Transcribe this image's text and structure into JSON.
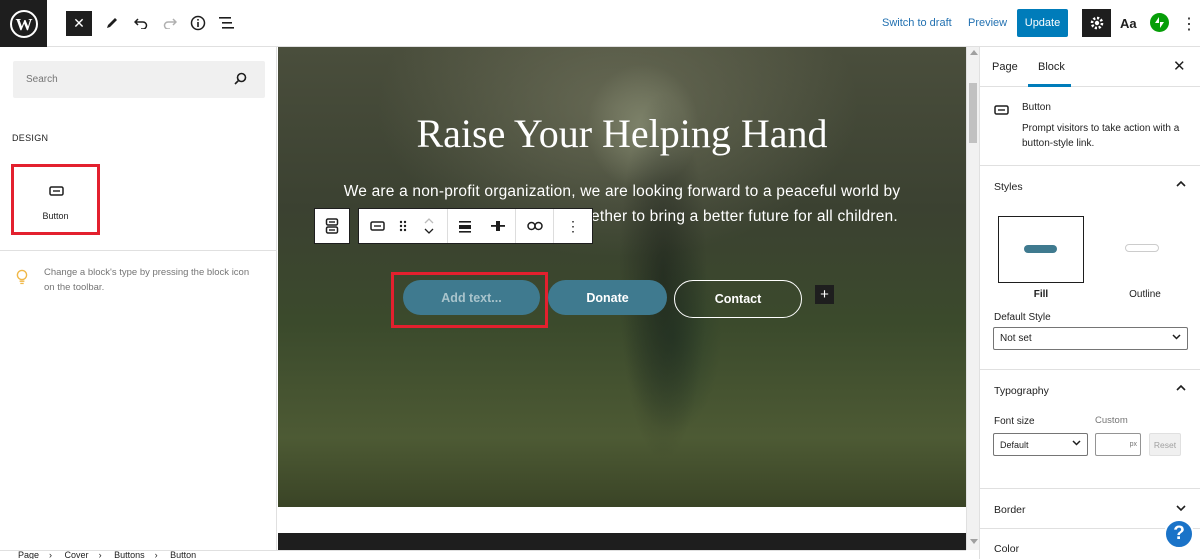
{
  "topbar": {
    "switch_to_draft": "Switch to draft",
    "preview": "Preview",
    "update": "Update",
    "typography_label": "Aa"
  },
  "inserter": {
    "search_placeholder": "Search",
    "design_heading": "DESIGN",
    "block_label": "Button",
    "tip": "Change a block's type by pressing the block icon on the toolbar."
  },
  "canvas": {
    "title": "Raise Your Helping Hand",
    "line1": "We are a non-profit organization, we are looking forward to a peaceful world by",
    "line2_visible": "ether to bring a better future for all children.",
    "button_add": "Add text...",
    "button_donate": "Donate",
    "button_contact": "Contact",
    "accent_color": "#3f7a8f"
  },
  "sidebar": {
    "tab_page": "Page",
    "tab_block": "Block",
    "block_title": "Button",
    "block_desc": "Prompt visitors to take action with a button-style link.",
    "styles_heading": "Styles",
    "style_fill": "Fill",
    "style_outline": "Outline",
    "default_style_label": "Default Style",
    "default_style_value": "Not set",
    "typography_heading": "Typography",
    "font_size_label": "Font size",
    "custom_label": "Custom",
    "font_size_value": "Default",
    "custom_unit": "px",
    "reset": "Reset",
    "border_heading": "Border",
    "color_heading": "Color"
  },
  "breadcrumb": [
    "Page",
    "Cover",
    "Buttons",
    "Button"
  ],
  "help_label": "?"
}
